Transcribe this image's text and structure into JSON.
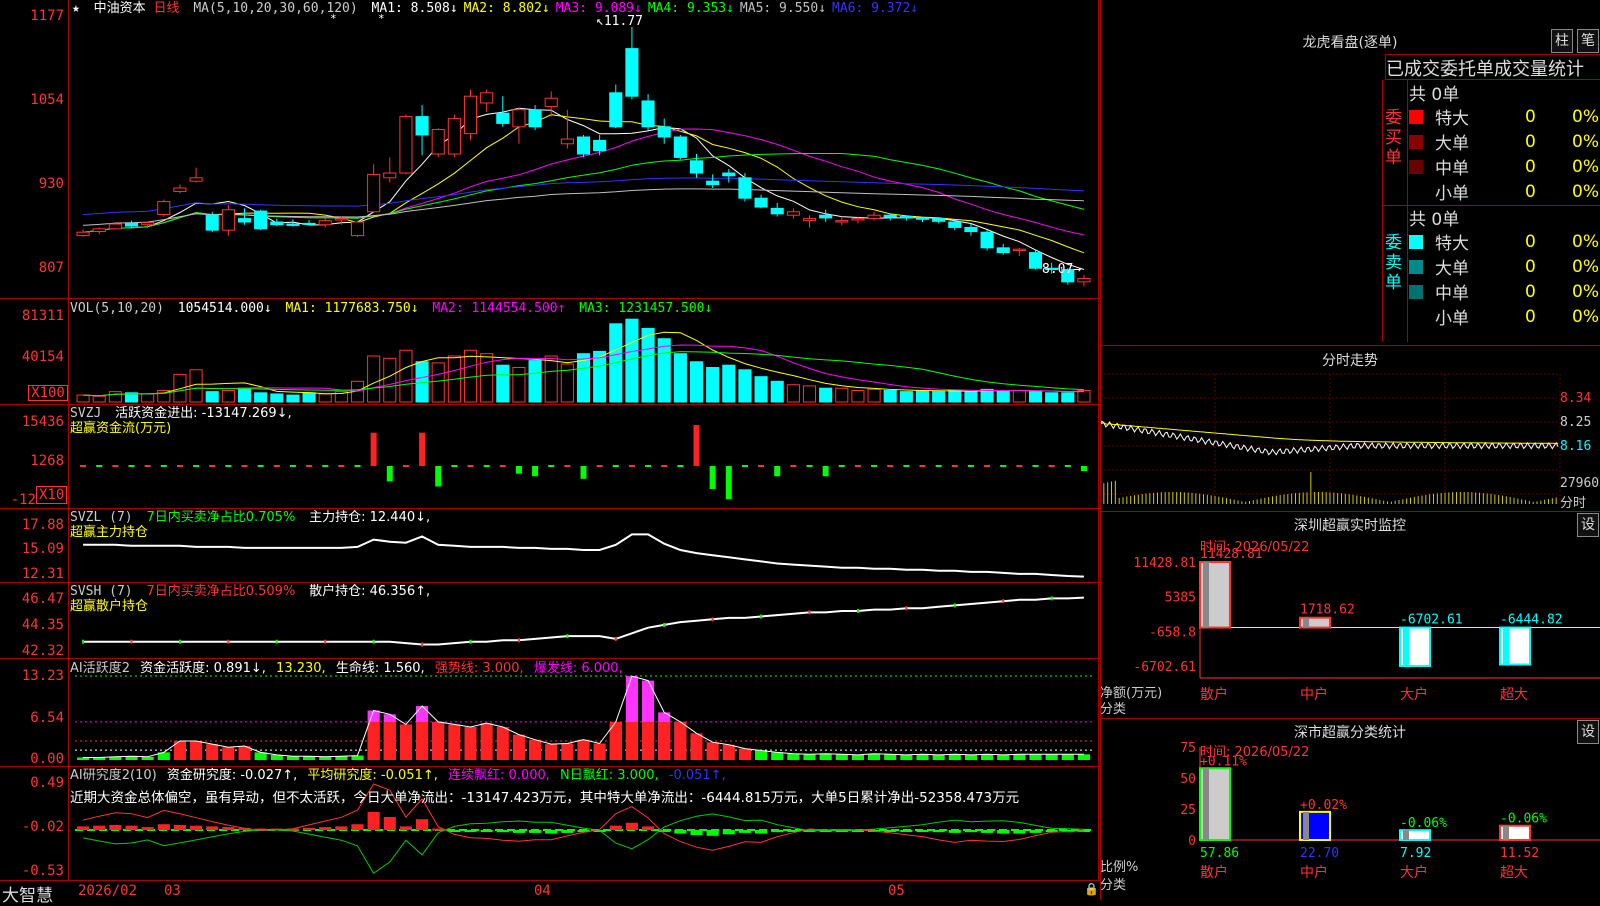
{
  "stock": {
    "name": "中油资本",
    "period": "日线",
    "ma_params": "MA(5,10,20,30,60,120)",
    "ma_values": [
      {
        "label": "MA1: 8.508↓",
        "color": "#ffffff"
      },
      {
        "label": "MA2: 8.802↓",
        "color": "#ffff00"
      },
      {
        "label": "MA3: 9.089↓",
        "color": "#ff00ff"
      },
      {
        "label": "MA4: 9.353↓",
        "color": "#00ff00"
      },
      {
        "label": "MA5: 9.550↓",
        "color": "#c0c0c0"
      },
      {
        "label": "MA6: 9.372↓",
        "color": "#3333ff"
      }
    ],
    "high_label": "11.77",
    "low_label": "8.07"
  },
  "price_axis": [
    "1177",
    "1054",
    "930",
    "807"
  ],
  "vol": {
    "header": "VOL(5,10,20)",
    "value": "1054514.000↓",
    "ma1": "MA1: 1177683.750↓",
    "ma2": "MA2: 1144554.500↑",
    "ma3": "MA3: 1231457.500↓",
    "axis": [
      "81311",
      "40154",
      "X100"
    ]
  },
  "svzj": {
    "header": "SVZJ",
    "label": "活跃资金进出: -13147.269↓,",
    "title": "超赢资金流(万元)",
    "axis": [
      "15436",
      "1268",
      "-12",
      "X10"
    ]
  },
  "svzl": {
    "header": "SVZL (7)",
    "label1": "7日内买卖净占比0.705%",
    "label2": "主力持仓: 12.440↓,",
    "title": "超赢主力持仓",
    "axis": [
      "17.88",
      "15.09",
      "12.31"
    ]
  },
  "svsh": {
    "header": "SVSH (7)",
    "label1": "7日内买卖净占比0.509%",
    "label2": "散户持仓: 46.356↑,",
    "title": "超赢散户持仓",
    "axis": [
      "46.47",
      "44.35",
      "42.32"
    ]
  },
  "ai_act": {
    "header": "AI活跃度2",
    "label1": "资金活跃度: 0.891↓,",
    "label2": "13.230,",
    "label3": "生命线: 1.560,",
    "label4": "强势线: 3.000,",
    "label5": "爆发线: 6.000,",
    "axis": [
      "13.23",
      "6.54",
      "0.00"
    ]
  },
  "ai_res": {
    "header": "AI研究度2(10)",
    "label1": "资金研究度: -0.027↑,",
    "label2": "平均研究度: -0.051↑,",
    "label3": "连续飘红: 0.000,",
    "label4": "N日飘红: 3.000,",
    "label5": "-0.051↑,",
    "comment": "近期大资金总体偏空，虽有异动，但不太活跃，今日大单净流出：-13147.423万元，其中特大单净流出：-6444.815万元，大单5日累计净出-52358.473万元",
    "axis": [
      "0.49",
      "-0.02",
      "-0.53"
    ]
  },
  "date_axis": {
    "brand": "大智慧",
    "labels": [
      "2026/02",
      "03",
      "04",
      "05"
    ]
  },
  "dragon": {
    "title": "龙虎看盘(逐单)",
    "btn1": "柱",
    "btn2": "笔",
    "subtitle": "已成交委托单成交量统计",
    "buy_side": "委买单",
    "sell_side": "委卖单",
    "buy_total": "共 0单",
    "sell_total": "共 0单",
    "buy_rows": [
      {
        "name": "特大",
        "count": "0",
        "pct": "0%",
        "color": "#ff0000"
      },
      {
        "name": "大单",
        "count": "0",
        "pct": "0%",
        "color": "#8b0000"
      },
      {
        "name": "中单",
        "count": "0",
        "pct": "0%",
        "color": "#6b0000"
      },
      {
        "name": "小单",
        "count": "0",
        "pct": "0%",
        "color": "#000000"
      }
    ],
    "sell_rows": [
      {
        "name": "特大",
        "count": "0",
        "pct": "0%",
        "color": "#00ffff"
      },
      {
        "name": "大单",
        "count": "0",
        "pct": "0%",
        "color": "#008b8b"
      },
      {
        "name": "中单",
        "count": "0",
        "pct": "0%",
        "color": "#007070"
      },
      {
        "name": "小单",
        "count": "0",
        "pct": "0%",
        "color": "#000000"
      }
    ]
  },
  "intraday": {
    "title": "分时走势",
    "axis": [
      "8.34",
      "8.25",
      "8.16",
      "27960",
      "分时"
    ]
  },
  "sz_monitor": {
    "title": "深圳超赢实时监控",
    "btn": "设",
    "time": "时间: 2026/05/22",
    "axis": [
      "11428.81",
      "5385",
      "-658.8",
      "-6702.61"
    ],
    "ylabel1": "净额(万元)",
    "ylabel2": "分类",
    "bars": [
      {
        "cat": "散户",
        "value": 11428.81,
        "label": "11428.81"
      },
      {
        "cat": "中户",
        "value": 1718.62,
        "label": "1718.62"
      },
      {
        "cat": "大户",
        "value": -6702.61,
        "label": "-6702.61"
      },
      {
        "cat": "超大",
        "value": -6444.82,
        "label": "-6444.82"
      }
    ]
  },
  "sz_class": {
    "title": "深市超赢分类统计",
    "btn": "设",
    "time": "时间: 2026/05/22",
    "axis": [
      "75",
      "50",
      "25",
      "0"
    ],
    "ylabel1": "比例%",
    "ylabel2": "分类",
    "bars": [
      {
        "cat": "散户",
        "value": 57.86,
        "label": "57.86",
        "delta": "+0.11%"
      },
      {
        "cat": "中户",
        "value": 22.7,
        "label": "22.70",
        "delta": "+0.02%"
      },
      {
        "cat": "大户",
        "value": 7.92,
        "label": "7.92",
        "delta": "-0.06%"
      },
      {
        "cat": "超大",
        "value": 11.52,
        "label": "11.52",
        "delta": "-0.06%"
      }
    ]
  },
  "chart_data": {
    "type": "candlestick",
    "title": "中油资本 日线",
    "ohlc": [
      [
        8.7,
        8.79,
        8.68,
        8.75
      ],
      [
        8.76,
        8.82,
        8.72,
        8.8
      ],
      [
        8.8,
        8.9,
        8.79,
        8.87
      ],
      [
        8.88,
        8.92,
        8.82,
        8.84
      ],
      [
        8.86,
        8.9,
        8.81,
        8.89
      ],
      [
        9.01,
        9.23,
        8.98,
        9.2
      ],
      [
        9.35,
        9.45,
        9.32,
        9.4
      ],
      [
        9.5,
        9.7,
        9.48,
        9.55
      ],
      [
        9.0,
        9.05,
        8.75,
        8.78
      ],
      [
        8.78,
        9.15,
        8.7,
        9.08
      ],
      [
        8.95,
        9.1,
        8.86,
        8.9
      ],
      [
        9.06,
        9.08,
        8.78,
        8.8
      ],
      [
        8.9,
        8.95,
        8.84,
        8.86
      ],
      [
        8.87,
        8.94,
        8.83,
        8.85
      ],
      [
        8.88,
        8.93,
        8.85,
        8.87
      ],
      [
        8.86,
        8.95,
        8.82,
        8.92
      ],
      [
        8.93,
        8.98,
        8.86,
        8.95
      ],
      [
        8.7,
        8.92,
        8.68,
        8.9
      ],
      [
        9.05,
        9.75,
        9.05,
        9.6
      ],
      [
        9.55,
        9.85,
        9.48,
        9.62
      ],
      [
        9.62,
        10.48,
        9.6,
        10.45
      ],
      [
        10.45,
        10.62,
        9.88,
        10.18
      ],
      [
        9.9,
        10.28,
        9.85,
        10.26
      ],
      [
        9.9,
        10.48,
        9.85,
        10.42
      ],
      [
        10.2,
        10.85,
        10.1,
        10.75
      ],
      [
        10.65,
        10.85,
        10.52,
        10.8
      ],
      [
        10.5,
        10.75,
        10.3,
        10.35
      ],
      [
        10.3,
        10.58,
        10.05,
        10.55
      ],
      [
        10.55,
        10.62,
        10.25,
        10.3
      ],
      [
        10.6,
        10.82,
        10.45,
        10.72
      ],
      [
        10.05,
        10.55,
        9.98,
        10.12
      ],
      [
        10.15,
        10.18,
        9.85,
        9.9
      ],
      [
        10.1,
        10.18,
        9.88,
        9.95
      ],
      [
        10.8,
        10.92,
        10.28,
        10.3
      ],
      [
        11.45,
        11.77,
        10.7,
        10.75
      ],
      [
        10.68,
        10.78,
        10.25,
        10.3
      ],
      [
        10.3,
        10.42,
        10.05,
        10.15
      ],
      [
        10.15,
        10.18,
        9.82,
        9.85
      ],
      [
        9.8,
        9.9,
        9.55,
        9.62
      ],
      [
        9.5,
        9.6,
        9.4,
        9.45
      ],
      [
        9.62,
        9.68,
        9.48,
        9.58
      ],
      [
        9.55,
        9.62,
        9.2,
        9.25
      ],
      [
        9.25,
        9.3,
        9.1,
        9.12
      ],
      [
        9.1,
        9.18,
        8.98,
        9.02
      ],
      [
        9.0,
        9.1,
        8.95,
        9.05
      ],
      [
        8.92,
        9.0,
        8.82,
        8.95
      ],
      [
        9.0,
        9.08,
        8.9,
        8.96
      ],
      [
        8.9,
        8.98,
        8.85,
        8.92
      ],
      [
        8.93,
        8.98,
        8.88,
        8.95
      ],
      [
        8.95,
        9.05,
        8.92,
        9.0
      ],
      [
        9.0,
        9.02,
        8.92,
        8.97
      ],
      [
        8.98,
        9.0,
        8.92,
        8.96
      ],
      [
        8.96,
        8.98,
        8.9,
        8.94
      ],
      [
        8.95,
        8.97,
        8.88,
        8.91
      ],
      [
        8.9,
        8.92,
        8.78,
        8.82
      ],
      [
        8.82,
        8.88,
        8.7,
        8.76
      ],
      [
        8.75,
        8.78,
        8.48,
        8.52
      ],
      [
        8.52,
        8.58,
        8.42,
        8.45
      ],
      [
        8.48,
        8.52,
        8.4,
        8.5
      ],
      [
        8.45,
        8.48,
        8.2,
        8.22
      ],
      [
        8.22,
        8.3,
        8.14,
        8.2
      ],
      [
        8.2,
        8.22,
        7.98,
        8.02
      ],
      [
        8.02,
        8.12,
        7.95,
        8.07
      ]
    ],
    "volume": [
      6,
      5,
      9,
      8,
      7,
      10,
      24,
      28,
      9,
      10,
      12,
      8,
      7,
      6,
      8,
      7,
      9,
      18,
      40,
      38,
      45,
      35,
      34,
      40,
      45,
      42,
      32,
      30,
      36,
      40,
      33,
      42,
      44,
      68,
      72,
      64,
      55,
      42,
      35,
      30,
      32,
      28,
      22,
      18,
      15,
      14,
      12,
      12,
      10,
      11,
      10,
      9,
      10,
      9,
      10,
      9,
      11,
      10,
      10,
      9,
      8,
      8,
      10
    ],
    "svzj": [
      0,
      0,
      0,
      0,
      0,
      0,
      0,
      0,
      0,
      0,
      0,
      0,
      0,
      0,
      0,
      0,
      0,
      0,
      13000,
      -6000,
      0,
      13000,
      -8000,
      0,
      0,
      0,
      0,
      -3000,
      -4000,
      0,
      0,
      -5000,
      0,
      0,
      0,
      0,
      0,
      0,
      16000,
      -9000,
      -13000,
      0,
      0,
      -4000,
      0,
      0,
      -4000,
      0,
      0,
      0,
      0,
      0,
      0,
      0,
      0,
      0,
      0,
      0,
      0,
      0,
      0,
      0,
      -2000
    ],
    "svzl": [
      15.5,
      15.5,
      15.5,
      15.4,
      15.4,
      15.4,
      15.4,
      15.3,
      15.3,
      15.3,
      15.2,
      15.2,
      15.2,
      15.2,
      15.2,
      15.2,
      15.2,
      15.3,
      16.0,
      15.8,
      15.7,
      16.3,
      15.5,
      15.4,
      15.3,
      15.3,
      15.3,
      15.2,
      15.2,
      15.1,
      15.1,
      15.0,
      15.0,
      15.5,
      16.5,
      16.5,
      15.6,
      15.0,
      14.7,
      14.5,
      14.3,
      14.1,
      13.9,
      13.7,
      13.6,
      13.5,
      13.4,
      13.3,
      13.3,
      13.2,
      13.2,
      13.1,
      13.1,
      13.0,
      13.0,
      12.9,
      12.9,
      12.8,
      12.7,
      12.7,
      12.6,
      12.5,
      12.44
    ],
    "svsh": [
      43.2,
      43.2,
      43.2,
      43.2,
      43.2,
      43.2,
      43.2,
      43.2,
      43.2,
      43.2,
      43.2,
      43.2,
      43.2,
      43.2,
      43.2,
      43.2,
      43.2,
      43.2,
      43.2,
      43.2,
      43.1,
      43.0,
      43.0,
      43.1,
      43.2,
      43.2,
      43.3,
      43.3,
      43.4,
      43.5,
      43.6,
      43.6,
      43.6,
      43.4,
      43.8,
      44.2,
      44.4,
      44.6,
      44.7,
      44.8,
      44.9,
      44.9,
      45.0,
      45.1,
      45.2,
      45.3,
      45.3,
      45.4,
      45.4,
      45.5,
      45.5,
      45.6,
      45.6,
      45.7,
      45.8,
      45.9,
      46.0,
      46.1,
      46.2,
      46.2,
      46.3,
      46.3,
      46.356
    ],
    "ai_act": [
      0.4,
      0.4,
      0.5,
      0.6,
      0.5,
      1.2,
      3.0,
      3.0,
      2.5,
      2.0,
      2.2,
      1.2,
      0.8,
      0.6,
      0.6,
      0.5,
      0.6,
      0.7,
      7.8,
      7.2,
      5.6,
      8.5,
      6.0,
      5.6,
      5.2,
      5.8,
      5.2,
      4.0,
      3.2,
      2.5,
      2.6,
      3.2,
      2.6,
      6.0,
      13.2,
      12.5,
      7.5,
      6.0,
      4.2,
      2.8,
      2.4,
      1.8,
      1.5,
      1.2,
      1.0,
      0.9,
      1.0,
      0.9,
      0.8,
      1.0,
      0.9,
      0.8,
      0.9,
      0.8,
      0.9,
      0.8,
      0.9,
      0.8,
      0.9,
      0.9,
      0.9,
      0.9,
      0.891
    ],
    "ai_res": [
      0.05,
      0.06,
      0.07,
      0.06,
      0.04,
      0.08,
      0.07,
      0.06,
      0.05,
      0.04,
      0.03,
      0.02,
      0.02,
      0.02,
      0.03,
      0.04,
      0.05,
      0.08,
      0.25,
      0.18,
      0.05,
      0.15,
      0.02,
      -0.01,
      -0.02,
      -0.02,
      -0.03,
      -0.04,
      -0.04,
      -0.05,
      -0.04,
      -0.03,
      -0.02,
      0.06,
      0.1,
      0.05,
      -0.02,
      -0.05,
      -0.07,
      -0.08,
      -0.06,
      -0.04,
      -0.05,
      -0.03,
      -0.02,
      -0.01,
      -0.02,
      -0.02,
      -0.02,
      -0.02,
      -0.02,
      -0.02,
      -0.02,
      -0.03,
      -0.04,
      -0.03,
      -0.04,
      -0.05,
      -0.05,
      -0.04,
      -0.03,
      -0.03,
      -0.027
    ],
    "ylim_price": [
      7.9,
      11.9
    ]
  }
}
